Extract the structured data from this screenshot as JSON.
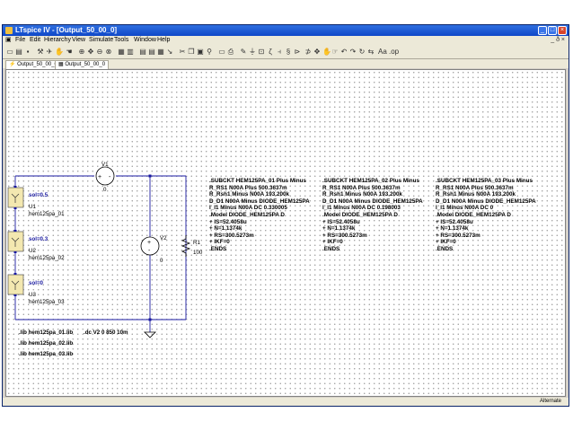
{
  "window": {
    "title": "LTspice IV - [Output_50_00_0]"
  },
  "menu": [
    "File",
    "Edit",
    "Hierarchy",
    "View",
    "Simulate",
    "Tools",
    "Window",
    "Help"
  ],
  "menu_right": "_ ð ×",
  "toolbar_icons": [
    "new",
    "open",
    "save",
    "control-panel",
    "run",
    "halt",
    "hand",
    "zoom-in",
    "pan",
    "zoom-out",
    "zoom-fit",
    "autorange",
    "schematic",
    "waves",
    "tile",
    "cascade",
    "cut",
    "copy",
    "paste",
    "find",
    "print",
    "print-preview",
    "wire",
    "ground",
    "label",
    "resistor",
    "capacitor",
    "inductor",
    "diode",
    "component",
    "move",
    "drag",
    "undo",
    "redo",
    "rotate",
    "mirror",
    "text",
    "spice-directive"
  ],
  "tabs": [
    {
      "label": "Output_50_00_0"
    },
    {
      "label": "Output_50_00_0"
    }
  ],
  "status": {
    "text": "Alternate"
  },
  "schematic": {
    "v1": {
      "name": "V1",
      "value": "0"
    },
    "v2": {
      "name": "V2",
      "value": "0"
    },
    "r1": {
      "name": "R1",
      "value": "100"
    },
    "u1": {
      "param": "sol=0.5",
      "name": "U1",
      "model": "hem125pa_01"
    },
    "u2": {
      "param": "sol=0.3",
      "name": "U2",
      "model": "hem125pa_02"
    },
    "u3": {
      "param": "sol=0",
      "name": "U3",
      "model": "hem125pa_03"
    },
    "directives": [
      ".lib hem125pa_01.lib",
      ".lib hem125pa_02.lib",
      ".lib hem125pa_03.lib"
    ],
    "dc_directive": ".dc V2 0 850 10m",
    "netlists": [
      [
        ".SUBCKT HEM125PA_01 Plus Minus",
        "R_RS1 N00A Plus 500.3637m",
        "R_Rsh1 Minus N00A 193.200k",
        "D_D1 N00A Minus DIODE_HEM125PA",
        "I_I1 Minus N00A DC 0.330005",
        ".Model DIODE_HEM125PA D",
        "+ IS=52.4058u",
        "+ N=1.1374k",
        "+ RS=300.5273m",
        "+ IKF=0",
        ".ENDS"
      ],
      [
        ".SUBCKT HEM125PA_02 Plus Minus",
        "R_RS1 N00A Plus 500.3637m",
        "R_Rsh1 Minus N00A 193.200k",
        "D_D1 N00A Minus DIODE_HEM125PA",
        "I_I1 Minus N00A DC 0.198003",
        ".Model DIODE_HEM125PA D",
        "+ IS=52.4058u",
        "+ N=1.1374k",
        "+ RS=300.5273m",
        "+ IKF=0",
        ".ENDS"
      ],
      [
        ".SUBCKT HEM125PA_03 Plus Minus",
        "R_RS1 N00A Plus 500.3637m",
        "R_Rsh1 Minus N00A 193.200k",
        "D_D1 N00A Minus DIODE_HEM125PA",
        "I_I1 Minus N00A DC 0",
        ".Model DIODE_HEM125PA D",
        "+ IS=52.4058u",
        "+ N=1.1374k",
        "+ RS=300.5273m",
        "+ IKF=0",
        ".ENDS"
      ]
    ]
  }
}
